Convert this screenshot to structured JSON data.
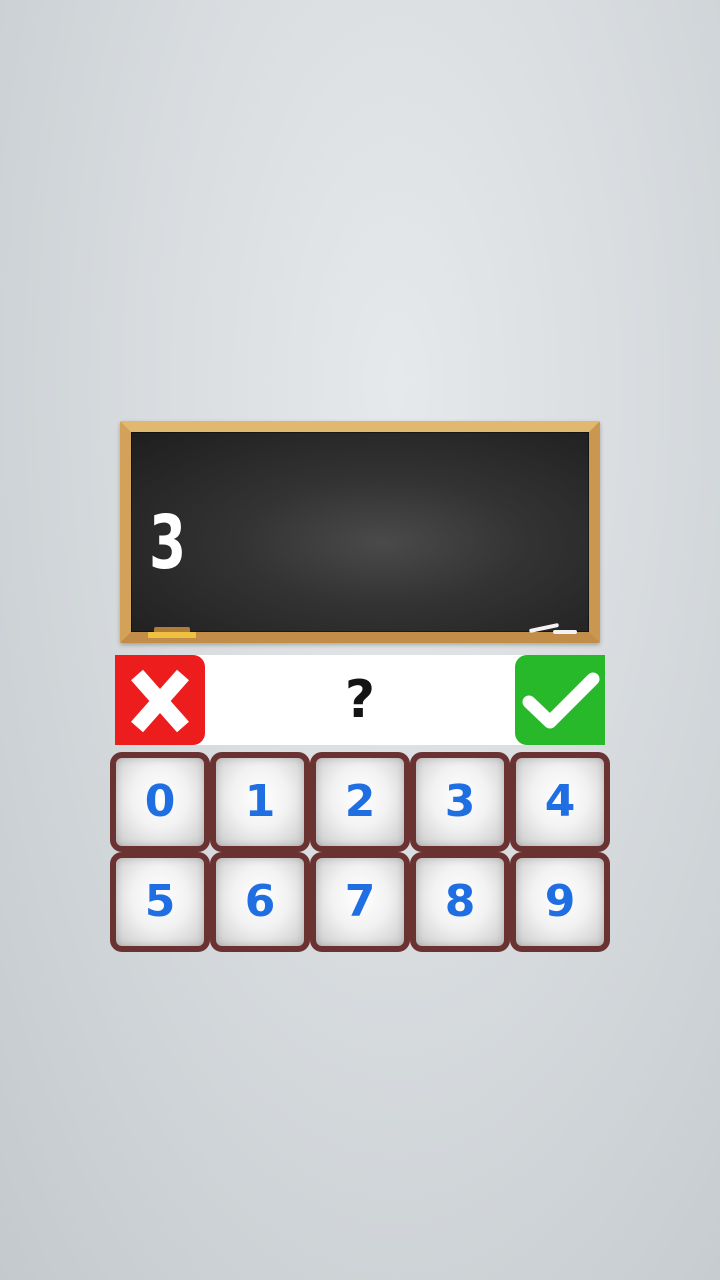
{
  "board": {
    "number": "3"
  },
  "answer": {
    "display": "?"
  },
  "keypad": {
    "keys": [
      "0",
      "1",
      "2",
      "3",
      "4",
      "5",
      "6",
      "7",
      "8",
      "9"
    ]
  },
  "colors": {
    "clear_button": "#ee1d1d",
    "submit_button": "#27b92a",
    "key_border": "#6b3232",
    "key_digit": "#1f6fe3",
    "board_frame": "#d6a95e"
  },
  "icons": {
    "clear": "close-icon",
    "submit": "checkmark-icon"
  }
}
